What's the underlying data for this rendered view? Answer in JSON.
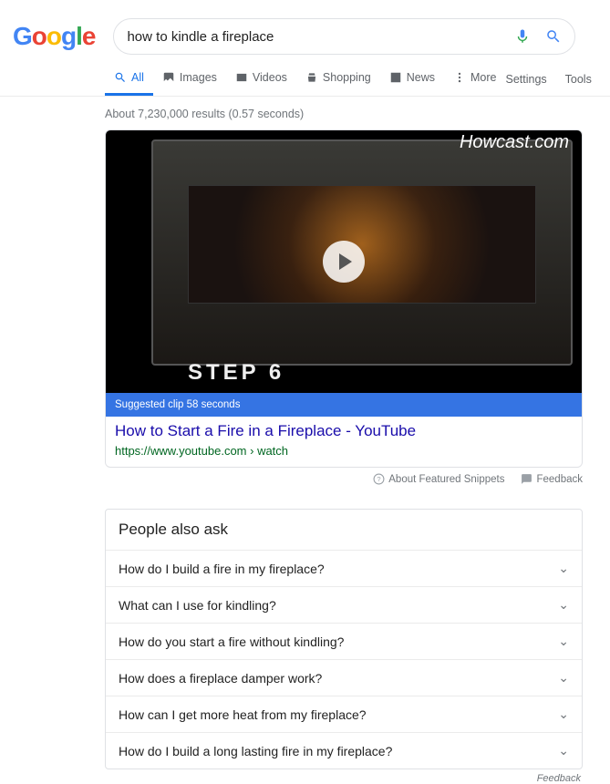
{
  "search": {
    "query": "how to kindle a fireplace"
  },
  "tabs": {
    "all": "All",
    "images": "Images",
    "videos": "Videos",
    "shopping": "Shopping",
    "news": "News",
    "more": "More",
    "settings": "Settings",
    "tools": "Tools"
  },
  "stats": "About 7,230,000 results (0.57 seconds)",
  "snippet": {
    "watermark": "Howcast.com",
    "step_text": "STEP  6",
    "clip_bar": "Suggested clip 58 seconds",
    "title": "How to Start a Fire in a Fireplace - YouTube",
    "url": "https://www.youtube.com › watch",
    "about": "About Featured Snippets",
    "feedback": "Feedback"
  },
  "paa": {
    "title": "People also ask",
    "items": [
      "How do I build a fire in my fireplace?",
      "What can I use for kindling?",
      "How do you start a fire without kindling?",
      "How does a fireplace damper work?",
      "How can I get more heat from my fireplace?",
      "How do I build a long lasting fire in my fireplace?"
    ]
  },
  "feedback_bottom": "Feedback"
}
